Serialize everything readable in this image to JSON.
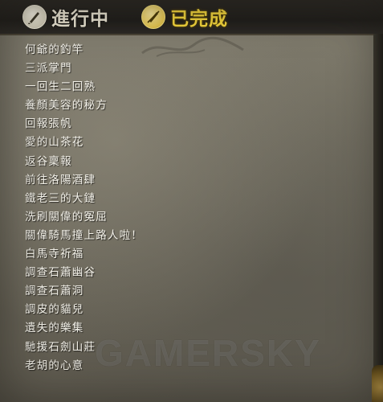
{
  "tabs": {
    "in_progress": {
      "label": "進行中",
      "icon": "brush-icon"
    },
    "completed": {
      "label": "已完成",
      "icon": "brush-slash-icon",
      "accent": "#f2d43c"
    }
  },
  "quests": [
    "何爺的釣竿",
    "三派掌門",
    "一回生二回熟",
    "養顏美容的秘方",
    "回報張帆",
    "愛的山茶花",
    "返谷稟報",
    "前往洛陽酒肆",
    "鐵老三的大鏈",
    "洗刷關偉的冤屈",
    "關偉騎馬撞上路人啦！",
    "白馬寺祈福",
    "調查石蕭幽谷",
    "調查石蕭洞",
    "調皮的貓兒",
    "遺失的樂集",
    "馳援石劍山莊",
    "老胡的心意"
  ],
  "watermark": "GAMERSKY"
}
